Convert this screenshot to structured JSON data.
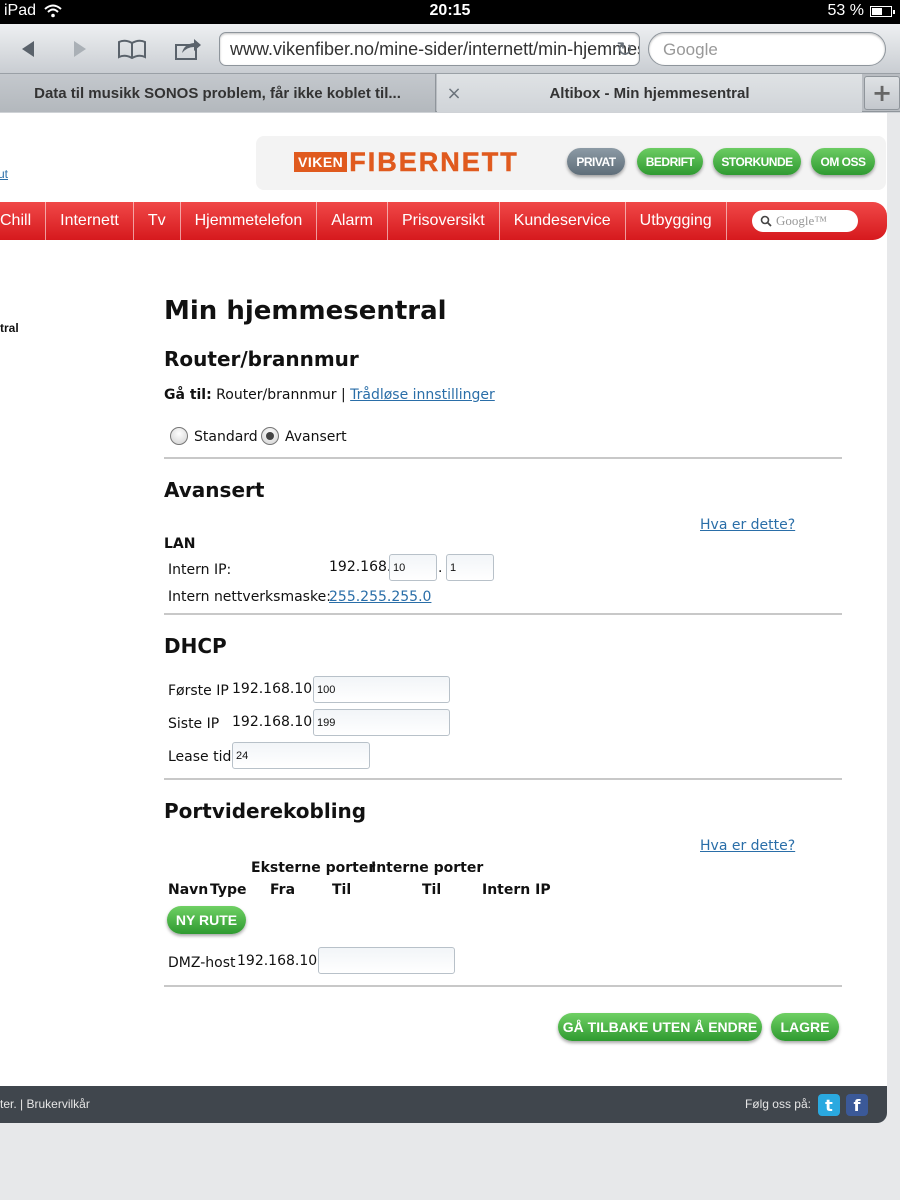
{
  "status_bar": {
    "device": "iPad",
    "time": "20:15",
    "battery": "53 %"
  },
  "toolbar": {
    "url": "www.vikenfiber.no/mine-sider/internett/min-hjemmesentral",
    "search_placeholder": "Google"
  },
  "tabs": {
    "inactive_title": "Data til musikk SONOS problem, får ikke koblet til...",
    "active_title": "Altibox - Min hjemmesentral",
    "close_glyph": "×",
    "new_glyph": "+"
  },
  "site": {
    "side_link": "ut",
    "logo_left": "VIKEN",
    "logo_right": "FIBERNETT",
    "top_buttons": [
      "PRIVAT",
      "BEDRIFT",
      "STORKUNDE",
      "OM OSS"
    ],
    "menu": [
      "Chill",
      "Internett",
      "Tv",
      "Hjemmetelefon",
      "Alarm",
      "Prisoversikt",
      "Kundeservice",
      "Utbygging"
    ],
    "menu_search_placeholder": "Google™",
    "side_text": "tral"
  },
  "main": {
    "title": "Min hjemmesentral",
    "subtitle": "Router/brannmur",
    "goto_label": "Gå til:",
    "goto_current": "Router/brannmur",
    "goto_sep": "|",
    "goto_link": "Trådløse innstillinger",
    "radio_standard": "Standard",
    "radio_avansert": "Avansert",
    "avansert_heading": "Avansert",
    "help_link": "Hva er dette?",
    "lan_heading": "LAN",
    "intern_ip_label": "Intern IP:",
    "intern_ip_prefix": "192.168.",
    "intern_ip_octet3": "10",
    "intern_ip_dot": ".",
    "intern_ip_octet4": "1",
    "netmask_label": "Intern nettverksmaske:",
    "netmask_value": "255.255.255.0",
    "dhcp_heading": "DHCP",
    "forste_ip_label": "Første IP",
    "forste_ip_prefix": "192.168.10.",
    "forste_ip_value": "100",
    "siste_ip_label": "Siste IP",
    "siste_ip_prefix": "192.168.10.",
    "siste_ip_value": "199",
    "lease_label": "Lease tid",
    "lease_value": "24",
    "port_heading": "Portviderekobling",
    "col_group_ext": "Eksterne porter",
    "col_group_int": "Interne porter",
    "col_navn": "Navn",
    "col_type": "Type",
    "col_fra": "Fra",
    "col_til": "Til",
    "col_til2": "Til",
    "col_intern_ip": "Intern IP",
    "ny_rute": "NY RUTE",
    "dmz_label": "DMZ-host",
    "dmz_prefix": "192.168.10.",
    "dmz_value": "",
    "btn_back": "GÅ TILBAKE UTEN Å ENDRE",
    "btn_save": "LAGRE"
  },
  "footer": {
    "left_text": "ter.",
    "left_sep": "|",
    "left_link": "Brukervilkår",
    "follow": "Følg oss på:",
    "twitter_glyph": "t",
    "facebook_glyph": "f"
  },
  "colors": {
    "menu_red": "#e52a2e",
    "brand_orange": "#e05a1e",
    "button_green": "#3aa63a",
    "pill_grey": "#6d7c87",
    "link_blue": "#2a6ea8",
    "footer_bg": "#40464d",
    "twitter_blue": "#2aa9e0",
    "facebook_blue": "#3b5998"
  }
}
